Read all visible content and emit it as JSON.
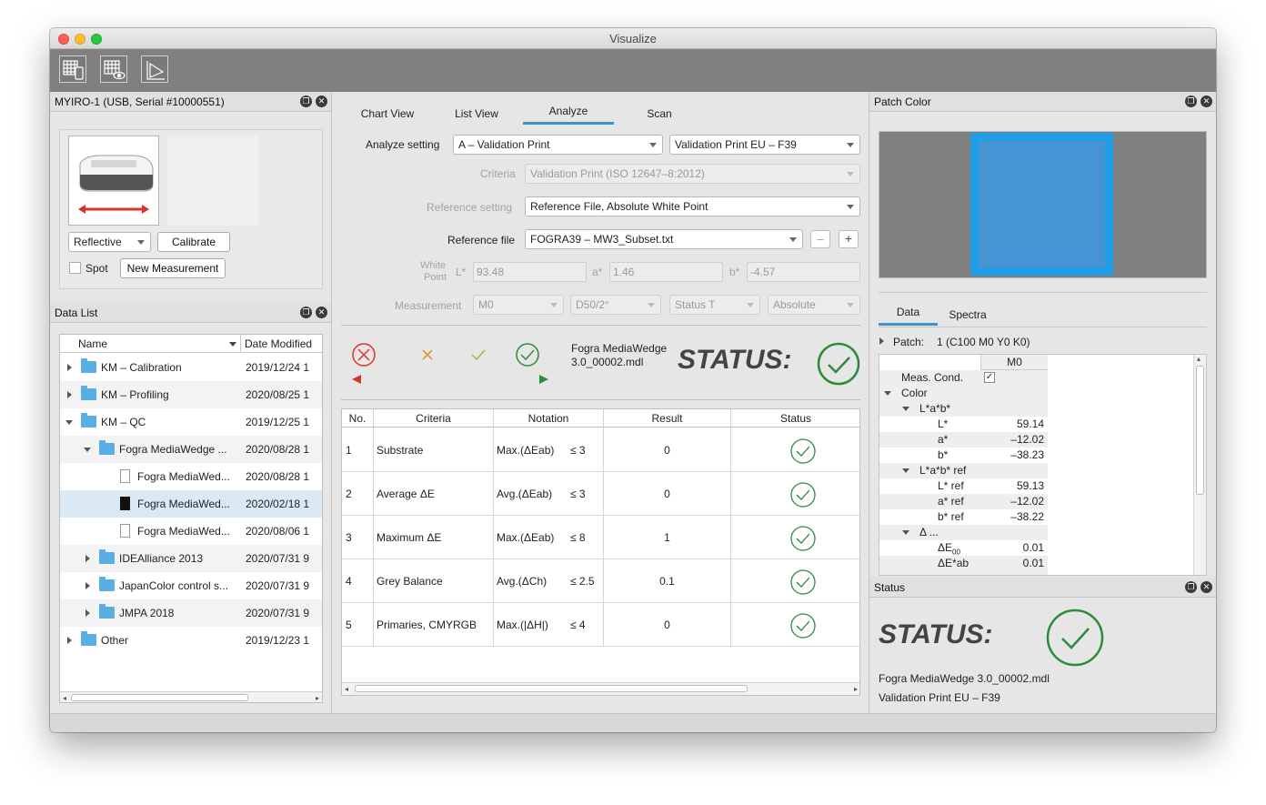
{
  "window": {
    "title": "Visualize"
  },
  "device_panel": {
    "title": "MYIRO-1 (USB, Serial #10000551)",
    "mode_select": "Reflective",
    "calibrate_button": "Calibrate",
    "spot_label": "Spot",
    "new_measurement_button": "New Measurement"
  },
  "data_list": {
    "title": "Data List",
    "col_name": "Name",
    "col_date": "Date Modified",
    "rows": [
      {
        "name": "KM – Calibration",
        "date": "2019/12/24 1"
      },
      {
        "name": "KM – Profiling",
        "date": "2020/08/25 1"
      },
      {
        "name": "KM – QC",
        "date": "2019/12/25 1"
      },
      {
        "name": "Fogra MediaWedge ...",
        "date": "2020/08/28 1"
      },
      {
        "name": "Fogra MediaWed...",
        "date": "2020/08/28 1"
      },
      {
        "name": "Fogra MediaWed...",
        "date": "2020/02/18 1"
      },
      {
        "name": "Fogra MediaWed...",
        "date": "2020/08/06 1"
      },
      {
        "name": "IDEAlliance 2013",
        "date": "2020/07/31 9"
      },
      {
        "name": "JapanColor control s...",
        "date": "2020/07/31 9"
      },
      {
        "name": "JMPA 2018",
        "date": "2020/07/31 9"
      },
      {
        "name": "Other",
        "date": "2019/12/23 1"
      }
    ]
  },
  "center": {
    "tabs": [
      "Chart View",
      "List View",
      "Analyze",
      "Scan"
    ],
    "active_tab": "Analyze",
    "analyze_setting_label": "Analyze setting",
    "analyze_setting_value": "A – Validation Print",
    "analyze_setting_value2": "Validation Print EU – F39",
    "criteria_label": "Criteria",
    "criteria_value": "Validation Print (ISO 12647–8:2012)",
    "reference_setting_label": "Reference setting",
    "reference_setting_value": "Reference File, Absolute White Point",
    "reference_file_label": "Reference file",
    "reference_file_value": "FOGRA39 – MW3_Subset.txt",
    "minus": "–",
    "plus": "+",
    "white_point_label_1": "White",
    "white_point_label_2": "Point",
    "l_label": "L*",
    "l_value": "93.48",
    "a_label": "a*",
    "a_value": "1.46",
    "b_label": "b*",
    "b_value": "-4.57",
    "measurement_label": "Measurement",
    "meas_m": "M0",
    "meas_d": "D50/2°",
    "meas_status": "Status T",
    "meas_abs": "Absolute",
    "file_line1": "Fogra MediaWedge",
    "file_line2": "3.0_00002.mdl",
    "status_text": "STATUS:",
    "table": {
      "headers": [
        "No.",
        "Criteria",
        "Notation",
        "Result",
        "Status"
      ],
      "rows": [
        {
          "no": "1",
          "criteria": "Substrate",
          "notation": "Max.(ΔEab)",
          "limit": "≤ 3",
          "result": "0"
        },
        {
          "no": "2",
          "criteria": "Average ΔE",
          "notation": "Avg.(ΔEab)",
          "limit": "≤ 3",
          "result": "0"
        },
        {
          "no": "3",
          "criteria": "Maximum ΔE",
          "notation": "Max.(ΔEab)",
          "limit": "≤ 8",
          "result": "1"
        },
        {
          "no": "4",
          "criteria": "Grey Balance",
          "notation": "Avg.(ΔCh)",
          "limit": "≤ 2.5",
          "result": "0.1"
        },
        {
          "no": "5",
          "criteria": "Primaries, CMYRGB",
          "notation": "Max.(|ΔH|)",
          "limit": "≤ 4",
          "result": "0"
        }
      ]
    }
  },
  "patch_panel": {
    "title": "Patch Color",
    "tabs": [
      "Data",
      "Spectra"
    ],
    "active_tab": "Data",
    "patch_label": "Patch:",
    "patch_value": "1 (C100 M0 Y0 K0)",
    "col_header": "M0",
    "rows": [
      {
        "label": "Meas. Cond.",
        "value": ""
      },
      {
        "label": "Color",
        "value": ""
      },
      {
        "label": "L*a*b*",
        "value": ""
      },
      {
        "label": "L*",
        "value": "59.14"
      },
      {
        "label": "a*",
        "value": "–12.02"
      },
      {
        "label": "b*",
        "value": "–38.23"
      },
      {
        "label": "L*a*b* ref",
        "value": ""
      },
      {
        "label": "L* ref",
        "value": "59.13"
      },
      {
        "label": "a* ref",
        "value": "–12.02"
      },
      {
        "label": "b* ref",
        "value": "–38.22"
      },
      {
        "label": "Δ ...",
        "value": ""
      },
      {
        "label": "ΔE",
        "value": "0.01"
      },
      {
        "label": "ΔE*ab",
        "value": "0.01"
      }
    ],
    "de_sub": "00"
  },
  "status_panel": {
    "title": "Status",
    "status_text": "STATUS:",
    "file": "Fogra MediaWedge 3.0_00002.mdl",
    "setting": "Validation Print EU – F39"
  },
  "colors": {
    "pass_green": "#2e8b3e",
    "patch_outer": "#1f9de6",
    "patch_inner": "#4695d2",
    "fail_red": "#d9342b",
    "warn_orange": "#e8862a"
  }
}
